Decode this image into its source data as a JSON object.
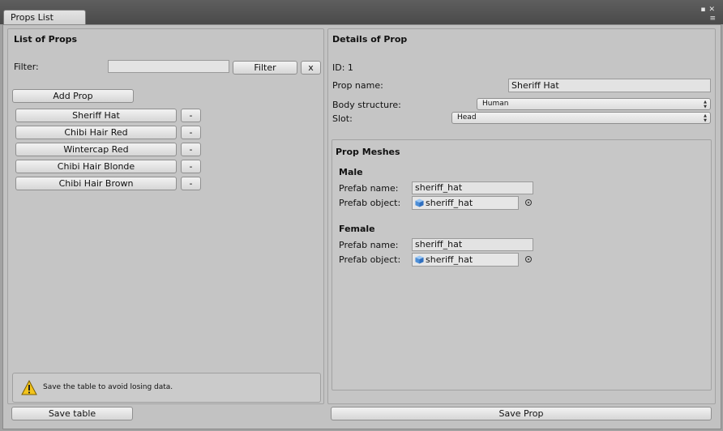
{
  "window": {
    "tab_title": "Props List",
    "controls": {
      "maximize_glyph": "▪",
      "close_glyph": "✕",
      "menu_glyph": "≡"
    }
  },
  "left": {
    "title": "List of Props",
    "filter_label": "Filter:",
    "filter_value": "",
    "filter_button": "Filter",
    "clear_button": "x",
    "add_button": "Add Prop",
    "remove_label": "-",
    "items": [
      {
        "label": "Sheriff Hat"
      },
      {
        "label": "Chibi Hair Red"
      },
      {
        "label": "Wintercap Red"
      },
      {
        "label": "Chibi Hair Blonde"
      },
      {
        "label": "Chibi Hair Brown"
      }
    ],
    "warning_text": "Save the table to avoid losing data.",
    "save_button": "Save table"
  },
  "right": {
    "title": "Details of Prop",
    "id_text": "ID: 1",
    "prop_name_label": "Prop name:",
    "prop_name_value": "Sheriff Hat",
    "body_structure_label": "Body structure:",
    "body_structure_value": "Human",
    "slot_label": "Slot:",
    "slot_value": "Head",
    "meshes": {
      "title": "Prop Meshes",
      "male": {
        "title": "Male",
        "prefab_name_label": "Prefab name:",
        "prefab_name_value": "sheriff_hat",
        "prefab_object_label": "Prefab object:",
        "prefab_object_value": "sheriff_hat"
      },
      "female": {
        "title": "Female",
        "prefab_name_label": "Prefab name:",
        "prefab_name_value": "sheriff_hat",
        "prefab_object_label": "Prefab object:",
        "prefab_object_value": "sheriff_hat"
      }
    },
    "save_button": "Save Prop"
  },
  "colors": {
    "window_bg": "#c2c2c2",
    "titlebar_bg": "#4f4f4f",
    "warning_yellow": "#f3c41b",
    "cube_blue": "#4d8fd8"
  },
  "icons": {
    "warning": "warning-triangle-icon",
    "prefab": "prefab-cube-icon",
    "object_picker": "object-picker-icon"
  }
}
